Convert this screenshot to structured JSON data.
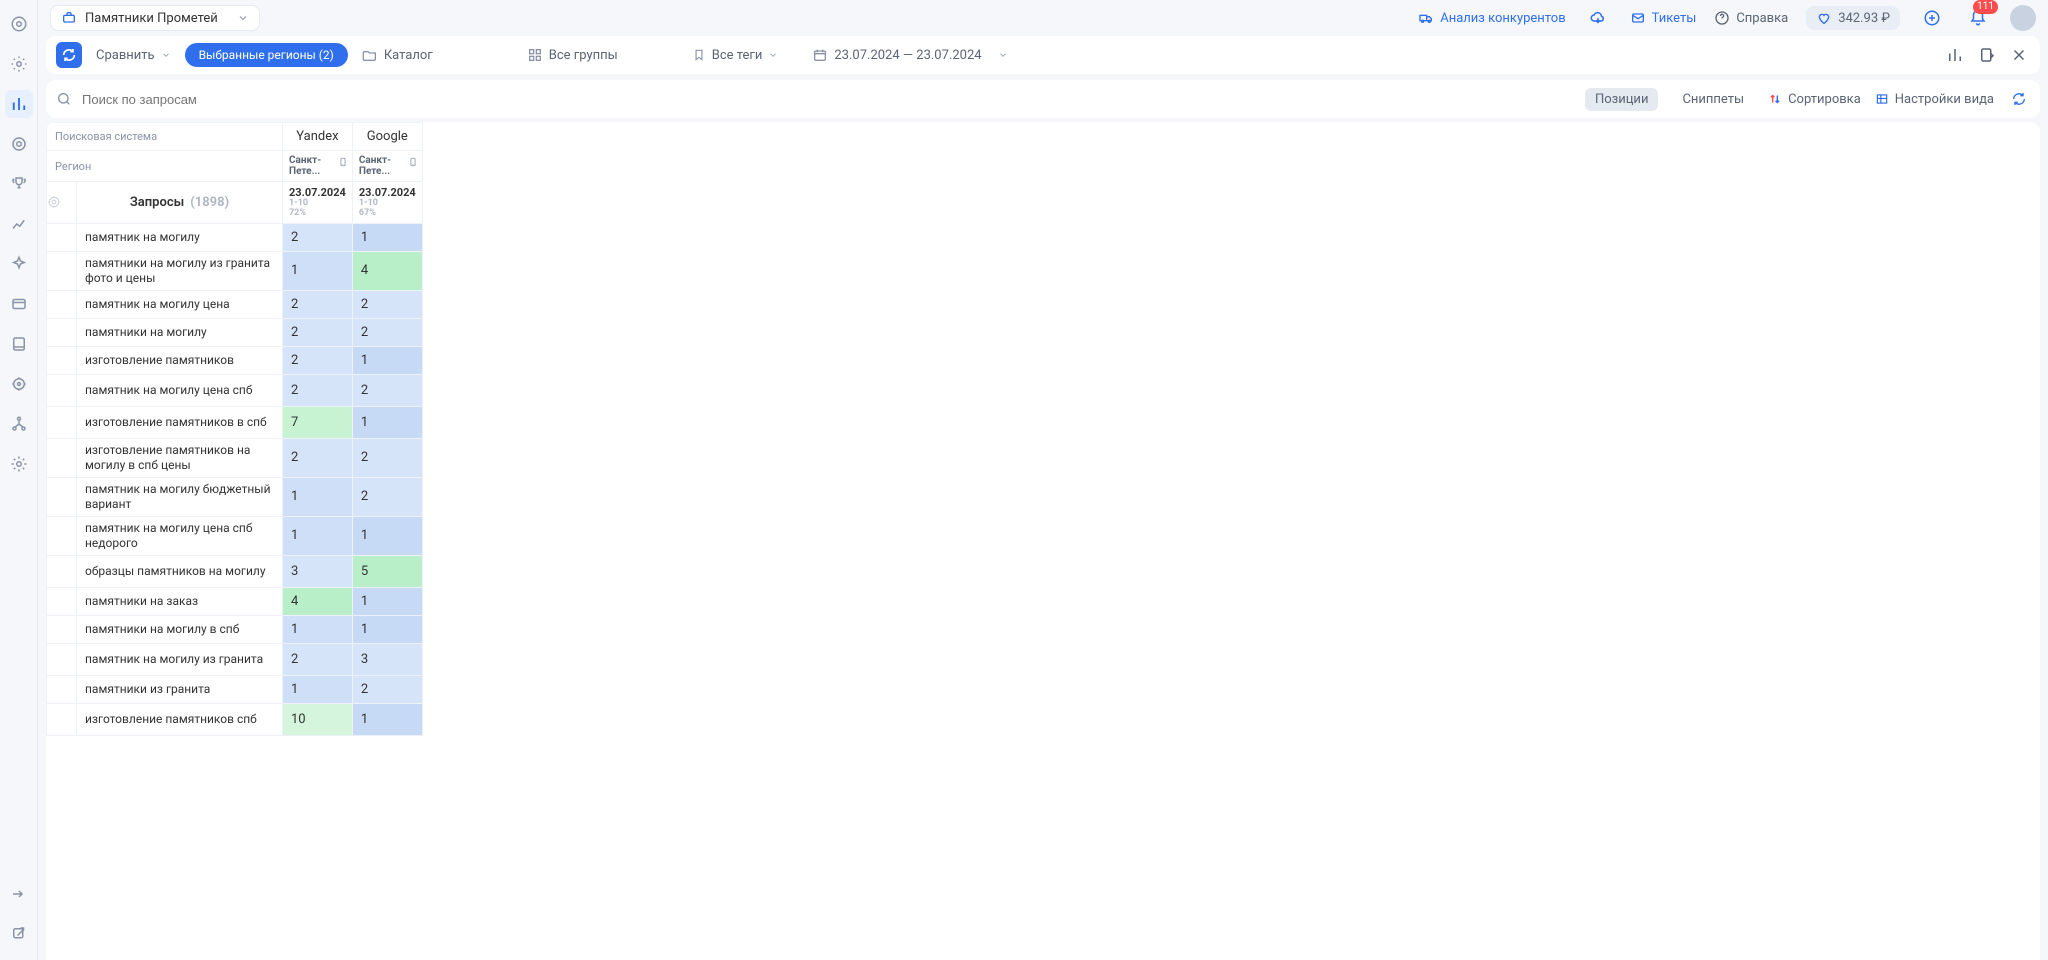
{
  "sidebar": {
    "items": [
      "logo",
      "radar",
      "positions",
      "target",
      "trophy",
      "chart",
      "spark",
      "panel",
      "book",
      "aim",
      "tree",
      "gear"
    ],
    "bottom": [
      "arrow",
      "external"
    ]
  },
  "topbar": {
    "project": "Памятники Прометей",
    "links": {
      "competitors": "Анализ конкурентов",
      "tickets": "Тикеты",
      "help": "Справка"
    },
    "balance": "342.93 ₽",
    "notif_count": "111"
  },
  "toolbar": {
    "compare": "Сравнить",
    "regions": "Выбранные регионы  (2)",
    "catalog": "Каталог",
    "groups": "Все группы",
    "tags": "Все теги",
    "dates": "23.07.2024 — 23.07.2024"
  },
  "searchbar": {
    "placeholder": "Поиск по запросам",
    "chips": {
      "positions": "Позиции",
      "snippets": "Сниппеты"
    },
    "sort": "Сортировка",
    "view": "Настройки вида"
  },
  "table": {
    "header": {
      "engine_label": "Поисковая система",
      "region_label": "Регион",
      "engines": [
        "Yandex",
        "Google"
      ],
      "regions": [
        "Санкт-Пете...",
        "Санкт-Пете..."
      ],
      "date": "23.07.2024",
      "sub_yandex_a": "1-10",
      "sub_yandex_b": "72%",
      "sub_google_a": "1-10",
      "sub_google_b": "67%",
      "queries_title": "Запросы",
      "queries_count": "(1898)"
    },
    "rows": [
      {
        "q": "памятник на могилу",
        "y": "2",
        "g": "1",
        "yc": "c-blue1",
        "gc": "c-blue3"
      },
      {
        "q": "памятники на могилу из гранита фото и цены",
        "y": "1",
        "g": "4",
        "yc": "c-blue2",
        "gc": "c-green1",
        "two": true
      },
      {
        "q": "памятник на могилу цена",
        "y": "2",
        "g": "2",
        "yc": "c-blue1",
        "gc": "c-blue1"
      },
      {
        "q": "памятники на могилу",
        "y": "2",
        "g": "2",
        "yc": "c-blue1",
        "gc": "c-blue1"
      },
      {
        "q": "изготовление памятников",
        "y": "2",
        "g": "1",
        "yc": "c-blue1",
        "gc": "c-blue3"
      },
      {
        "q": "памятник на могилу цена спб",
        "y": "2",
        "g": "2",
        "yc": "c-blue1",
        "gc": "c-blue1",
        "two": true
      },
      {
        "q": "изготовление памятников в спб",
        "y": "7",
        "g": "1",
        "yc": "c-green2",
        "gc": "c-blue3",
        "two": true
      },
      {
        "q": "изготовление памятников на могилу в спб цены",
        "y": "2",
        "g": "2",
        "yc": "c-blue1",
        "gc": "c-blue1",
        "two": true
      },
      {
        "q": "памятник на могилу бюджетный вариант",
        "y": "1",
        "g": "2",
        "yc": "c-blue2",
        "gc": "c-blue1",
        "two": true
      },
      {
        "q": "памятник на могилу цена спб недорого",
        "y": "1",
        "g": "1",
        "yc": "c-blue2",
        "gc": "c-blue3",
        "two": true
      },
      {
        "q": "образцы памятников на могилу",
        "y": "3",
        "g": "5",
        "yc": "c-blue1",
        "gc": "c-green1",
        "two": true
      },
      {
        "q": "памятники на заказ",
        "y": "4",
        "g": "1",
        "yc": "c-green1",
        "gc": "c-blue3"
      },
      {
        "q": "памятники на могилу в спб",
        "y": "1",
        "g": "1",
        "yc": "c-blue2",
        "gc": "c-blue3"
      },
      {
        "q": "памятник на могилу из гранита",
        "y": "2",
        "g": "3",
        "yc": "c-blue1",
        "gc": "c-blue1",
        "two": true
      },
      {
        "q": "памятники из гранита",
        "y": "1",
        "g": "2",
        "yc": "c-blue2",
        "gc": "c-blue1"
      },
      {
        "q": "изготовление памятников спб",
        "y": "10",
        "g": "1",
        "yc": "c-green3",
        "gc": "c-blue3",
        "two": true
      }
    ]
  }
}
